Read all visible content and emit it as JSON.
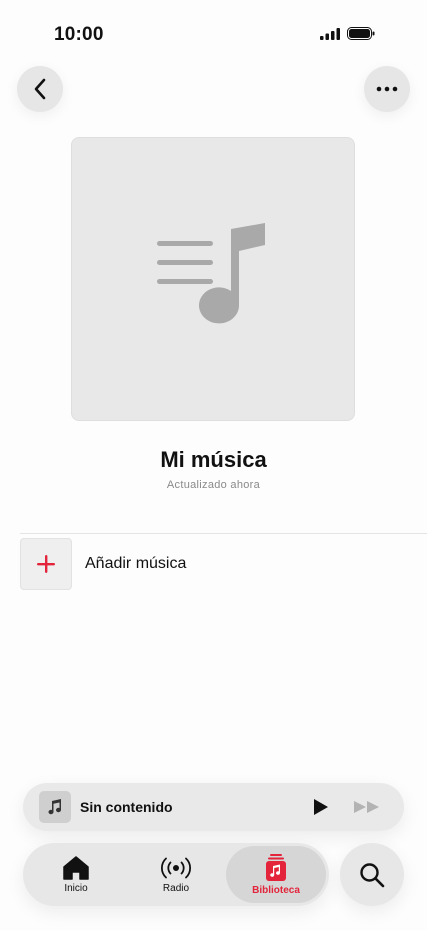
{
  "status_bar": {
    "time": "10:00"
  },
  "header": {
    "back_icon": "chevron-left-icon",
    "more_icon": "ellipsis-icon"
  },
  "playlist": {
    "artwork_icon": "music-list-icon",
    "title": "Mi música",
    "subtitle": "Actualizado ahora"
  },
  "actions": {
    "add_music_label": "Añadir música",
    "add_icon": "plus-icon"
  },
  "mini_player": {
    "title": "Sin contenido",
    "play_icon": "play-icon",
    "forward_icon": "fast-forward-icon"
  },
  "tab_bar": {
    "tabs": [
      {
        "label": "Inicio",
        "icon": "home-icon"
      },
      {
        "label": "Radio",
        "icon": "radio-icon"
      },
      {
        "label": "Biblioteca",
        "icon": "library-icon",
        "active": true
      }
    ],
    "search_icon": "search-icon"
  },
  "colors": {
    "accent": "#e3243a",
    "background": "#fdfdfd",
    "surface": "#e7e7e7"
  }
}
